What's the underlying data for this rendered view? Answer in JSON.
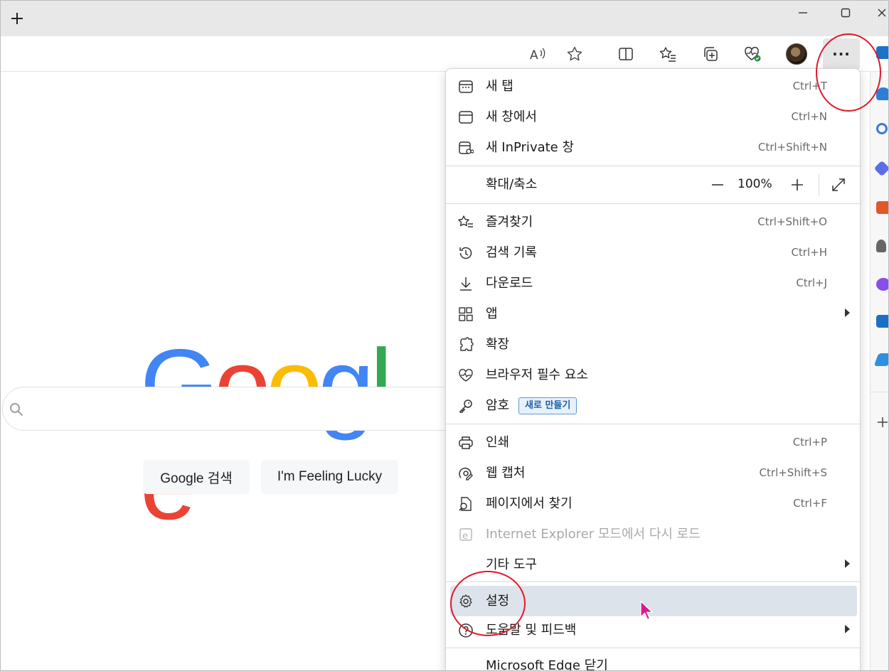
{
  "titlebar": {
    "new_tab_icon": "plus-icon",
    "minimize_icon": "minimize-icon",
    "maximize_icon": "maximize-icon",
    "close_icon": "close-icon"
  },
  "toolbar": {
    "icons": [
      "read-aloud-icon",
      "favorite-star-icon",
      "split-screen-icon",
      "favorites-icon",
      "collections-icon",
      "browser-essentials-icon",
      "profile-avatar",
      "more-icon"
    ],
    "more_label": "···"
  },
  "google": {
    "logo_letters": [
      {
        "ch": "G",
        "color": "#4285f4"
      },
      {
        "ch": "o",
        "color": "#ea4335"
      },
      {
        "ch": "o",
        "color": "#fbbc05"
      },
      {
        "ch": "g",
        "color": "#4285f4"
      },
      {
        "ch": "l",
        "color": "#34a853"
      },
      {
        "ch": "e",
        "color": "#ea4335"
      }
    ],
    "search_button": "Google 검색",
    "lucky_button": "I'm Feeling Lucky"
  },
  "menu": {
    "new_tab": {
      "label": "새 탭",
      "shortcut": "Ctrl+T"
    },
    "new_window": {
      "label": "새 창에서",
      "shortcut": "Ctrl+N"
    },
    "inprivate": {
      "label": "새 InPrivate 창",
      "shortcut": "Ctrl+Shift+N"
    },
    "zoom": {
      "label": "확대/축소",
      "minus": "—",
      "value": "100%",
      "plus": "+"
    },
    "favorites": {
      "label": "즐겨찾기",
      "shortcut": "Ctrl+Shift+O"
    },
    "history": {
      "label": "검색 기록",
      "shortcut": "Ctrl+H"
    },
    "downloads": {
      "label": "다운로드",
      "shortcut": "Ctrl+J"
    },
    "apps": {
      "label": "앱"
    },
    "extensions": {
      "label": "확장"
    },
    "essentials": {
      "label": "브라우저 필수 요소"
    },
    "passwords": {
      "label": "암호",
      "badge": "새로 만들기"
    },
    "print": {
      "label": "인쇄",
      "shortcut": "Ctrl+P"
    },
    "web_capture": {
      "label": "웹 캡처",
      "shortcut": "Ctrl+Shift+S"
    },
    "find": {
      "label": "페이지에서 찾기",
      "shortcut": "Ctrl+F"
    },
    "ie_mode": {
      "label": "Internet Explorer 모드에서 다시 로드"
    },
    "more_tools": {
      "label": "기타 도구"
    },
    "settings": {
      "label": "설정"
    },
    "help": {
      "label": "도움말 및 피드백"
    },
    "close_edge": {
      "label": "Microsoft Edge 닫기"
    }
  },
  "colors": {
    "highlight": "#dde3ea",
    "annotation_red": "#e0182a",
    "cursor": "#d81b8c"
  }
}
